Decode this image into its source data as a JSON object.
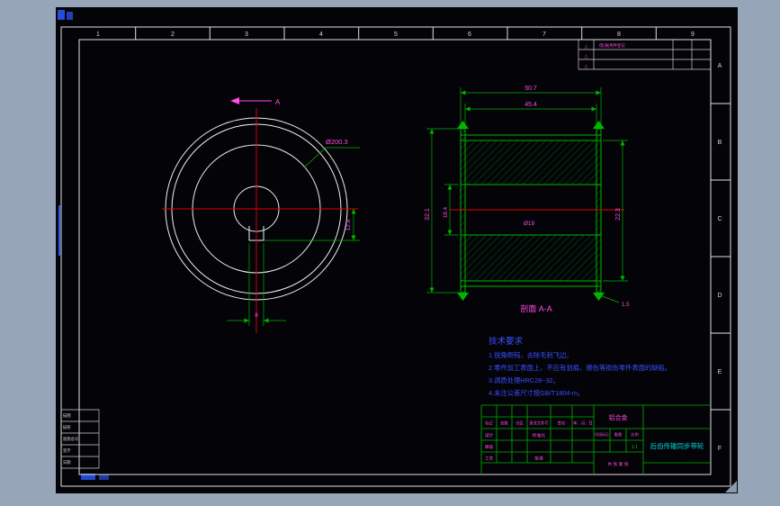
{
  "colors": {
    "desktop": "#96a6b8",
    "paper": "#000000",
    "sheet_white": "#e0e0e0",
    "line_green": "#00b400",
    "centerline_red": "#e60000",
    "dim_magenta": "#ff4de0",
    "note_blue": "#3c50ff",
    "name_cyan": "#00dcdc"
  },
  "sheet": {
    "zone_numbers": [
      "1",
      "2",
      "3",
      "4",
      "5",
      "6",
      "7",
      "8",
      "9"
    ],
    "zone_letters": [
      "A",
      "B",
      "C",
      "D",
      "E",
      "F"
    ]
  },
  "front_view": {
    "section_label": "A",
    "diameter_label": "Ø200.3",
    "dim_keyway_depth": "12.8",
    "dim_keyway_width": "8"
  },
  "section_view": {
    "dim_overall_width": "50.7",
    "dim_belt_width": "45.4",
    "dim_overall_height": "32.1",
    "dim_bore": "18.4",
    "dim_rim_height": "22.3",
    "dim_flange": "1.5",
    "bore_label": "Ø19",
    "caption": "剖面 A-A"
  },
  "tech_req": {
    "title": "技术要求",
    "items": [
      "1.锐角倒钝，去除毛刺飞边。",
      "2.零件加工表面上，不应有划痕、擦伤等损伤零件表面的缺陷。",
      "3.调质处理HRC28~32。",
      "4.未注公差尺寸按GB/T1804-m。"
    ]
  },
  "title_block": {
    "material": "铝合金",
    "part_name": "后齿传输同步带轮",
    "header": {
      "mark": "标记",
      "count": "处数",
      "zone": "分区",
      "file_no": "更改文件号",
      "sign": "签名",
      "date": "年、月、日"
    },
    "roles": {
      "design": "设计",
      "audit": "审核",
      "process": "工艺",
      "standard": "标准化",
      "approve": "批准"
    },
    "stage_label": "阶段标记",
    "weight_label": "重量",
    "scale_label": "比例",
    "scale_value": "1:1",
    "sheets_label": "共 张 第 张"
  },
  "aux_top": {
    "marks": [
      "△",
      "△",
      "△"
    ],
    "note": "借(通)用件登记"
  },
  "aux_left": {
    "rows": [
      "描图",
      "描校",
      "底图总号",
      "签字",
      "日期"
    ]
  }
}
